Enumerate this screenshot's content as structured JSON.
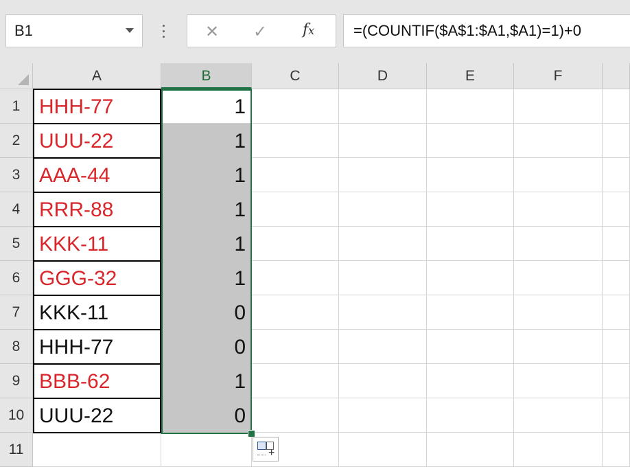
{
  "name_box": "B1",
  "formula": "=(COUNTIF($A$1:$A1,$A1)=1)+0",
  "formula_bar_icons": [
    "cancel-icon",
    "enter-icon",
    "fx-icon"
  ],
  "columns": [
    "A",
    "B",
    "C",
    "D",
    "E",
    "F"
  ],
  "rows": [
    "1",
    "2",
    "3",
    "4",
    "5",
    "6",
    "7",
    "8",
    "9",
    "10",
    "11"
  ],
  "cells": [
    {
      "a": "HHH-77",
      "b": "1",
      "a_color": "#d9262b"
    },
    {
      "a": "UUU-22",
      "b": "1",
      "a_color": "#d9262b"
    },
    {
      "a": "AAA-44",
      "b": "1",
      "a_color": "#d9262b"
    },
    {
      "a": "RRR-88",
      "b": "1",
      "a_color": "#d9262b"
    },
    {
      "a": "KKK-11",
      "b": "1",
      "a_color": "#d9262b"
    },
    {
      "a": "GGG-32",
      "b": "1",
      "a_color": "#d9262b"
    },
    {
      "a": "KKK-11",
      "b": "0",
      "a_color": "#111111"
    },
    {
      "a": "HHH-77",
      "b": "0",
      "a_color": "#111111"
    },
    {
      "a": "BBB-62",
      "b": "1",
      "a_color": "#d9262b"
    },
    {
      "a": "UUU-22",
      "b": "0",
      "a_color": "#111111"
    }
  ],
  "selection_color": "#217346"
}
